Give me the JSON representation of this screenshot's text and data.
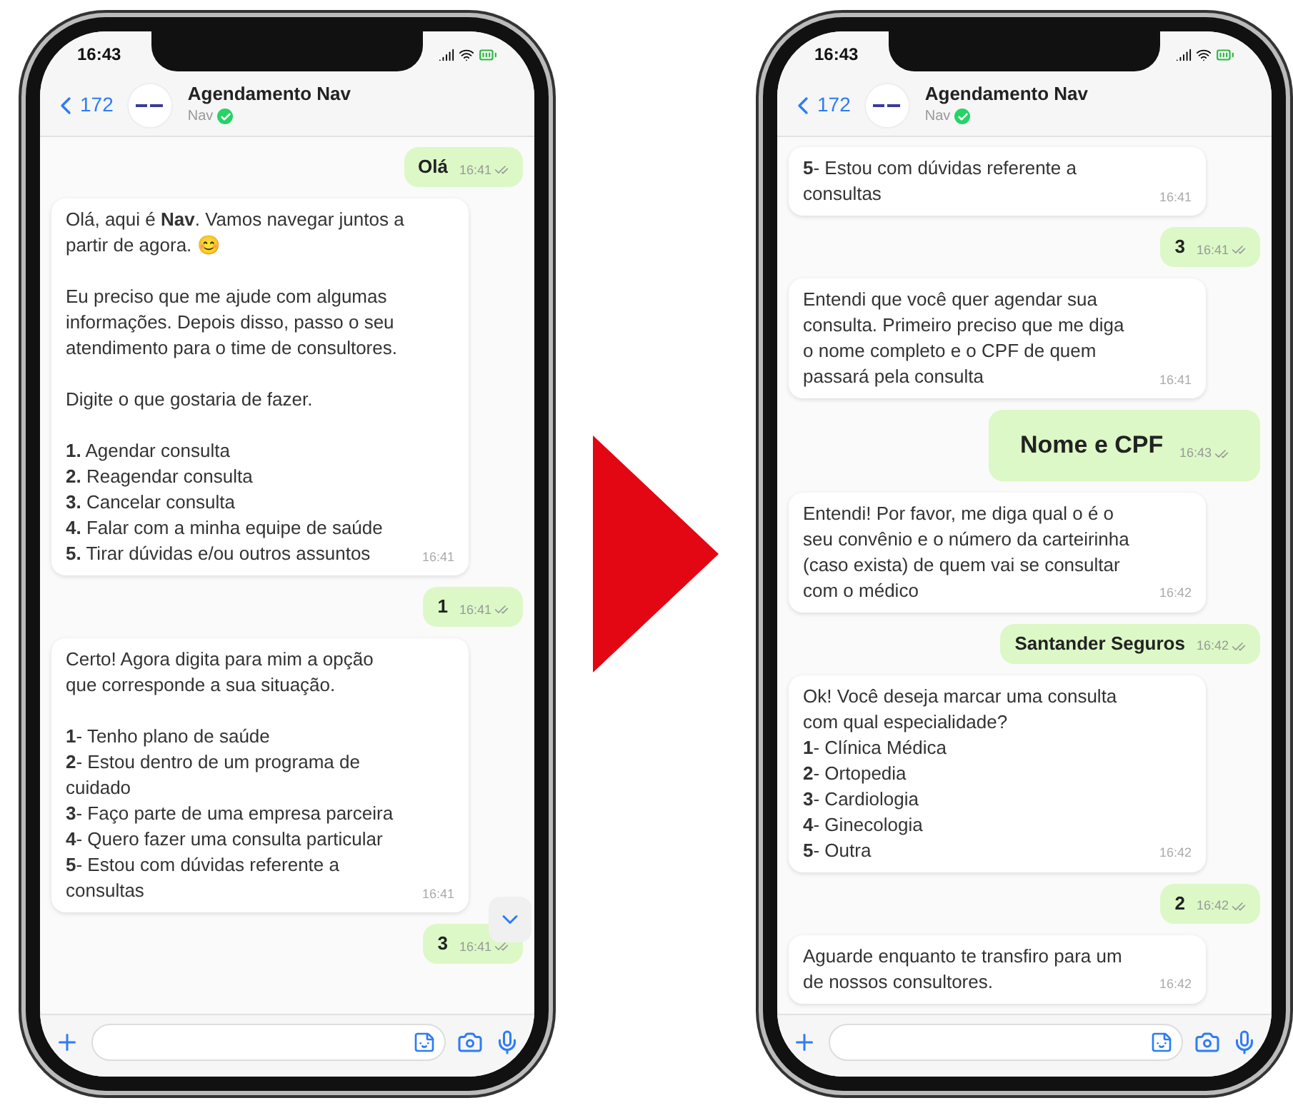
{
  "phones": [
    {
      "status_time": "16:43",
      "back_count": "172",
      "chat_title": "Agendamento Nav",
      "chat_subtitle": "Nav",
      "verified": true,
      "scroll_button": true,
      "messages": [
        {
          "kind": "out",
          "text": "Olá",
          "time": "16:41",
          "large": false
        },
        {
          "kind": "in",
          "text": "Olá, aqui é **Nav**. Vamos navegar juntos a\npartir de agora. 😊\n\nEu preciso que me ajude com algumas\ninformações. Depois disso, passo o seu\natendimento para o time de consultores.\n\nDigite o que gostaria de fazer.\n\n**1.** Agendar consulta\n**2.** Reagendar consulta\n**3.** Cancelar consulta\n**4.** Falar com a minha equipe de saúde\n**5.** Tirar dúvidas e/ou outros assuntos",
          "time": "16:41"
        },
        {
          "kind": "out",
          "text": "1",
          "time": "16:41",
          "large": false
        },
        {
          "kind": "in",
          "text": "Certo! Agora digita para mim a opção\nque corresponde a sua situação.\n\n**1**- Tenho plano de saúde\n**2**- Estou dentro de um programa de\ncuidado\n**3**- Faço parte de uma empresa parceira\n**4**- Quero fazer uma consulta particular\n**5**- Estou com dúvidas referente a\nconsultas",
          "time": "16:41"
        },
        {
          "kind": "out",
          "text": "3",
          "time": "16:41",
          "large": false
        }
      ]
    },
    {
      "status_time": "16:43",
      "back_count": "172",
      "chat_title": "Agendamento Nav",
      "chat_subtitle": "Nav",
      "verified": true,
      "messages": [
        {
          "kind": "in",
          "text": "**5**- Estou com dúvidas referente a\nconsultas",
          "time": "16:41"
        },
        {
          "kind": "out",
          "text": "3",
          "time": "16:41",
          "large": false
        },
        {
          "kind": "in",
          "text": "Entendi que você quer agendar sua\nconsulta. Primeiro preciso que me diga\no nome completo e o CPF de quem\npassará pela consulta",
          "time": "16:41"
        },
        {
          "kind": "out",
          "text": "Nome e CPF",
          "time": "16:43",
          "large": true
        },
        {
          "kind": "in",
          "text": "Entendi! Por favor, me diga qual o é o\nseu convênio e o número da carteirinha\n(caso exista) de quem vai se consultar\ncom o médico",
          "time": "16:42"
        },
        {
          "kind": "out",
          "text": "Santander Seguros",
          "time": "16:42",
          "large": false
        },
        {
          "kind": "in",
          "text": "Ok! Você deseja marcar uma consulta\ncom qual especialidade?\n**1**- Clínica Médica\n**2**- Ortopedia\n**3**- Cardiologia\n**4**- Ginecologia\n**5**- Outra",
          "time": "16:42"
        },
        {
          "kind": "out",
          "text": "2",
          "time": "16:42",
          "large": false
        },
        {
          "kind": "in",
          "text": "Aguarde enquanto te transfiro para um\nde nossos consultores.",
          "time": "16:42"
        }
      ]
    }
  ]
}
